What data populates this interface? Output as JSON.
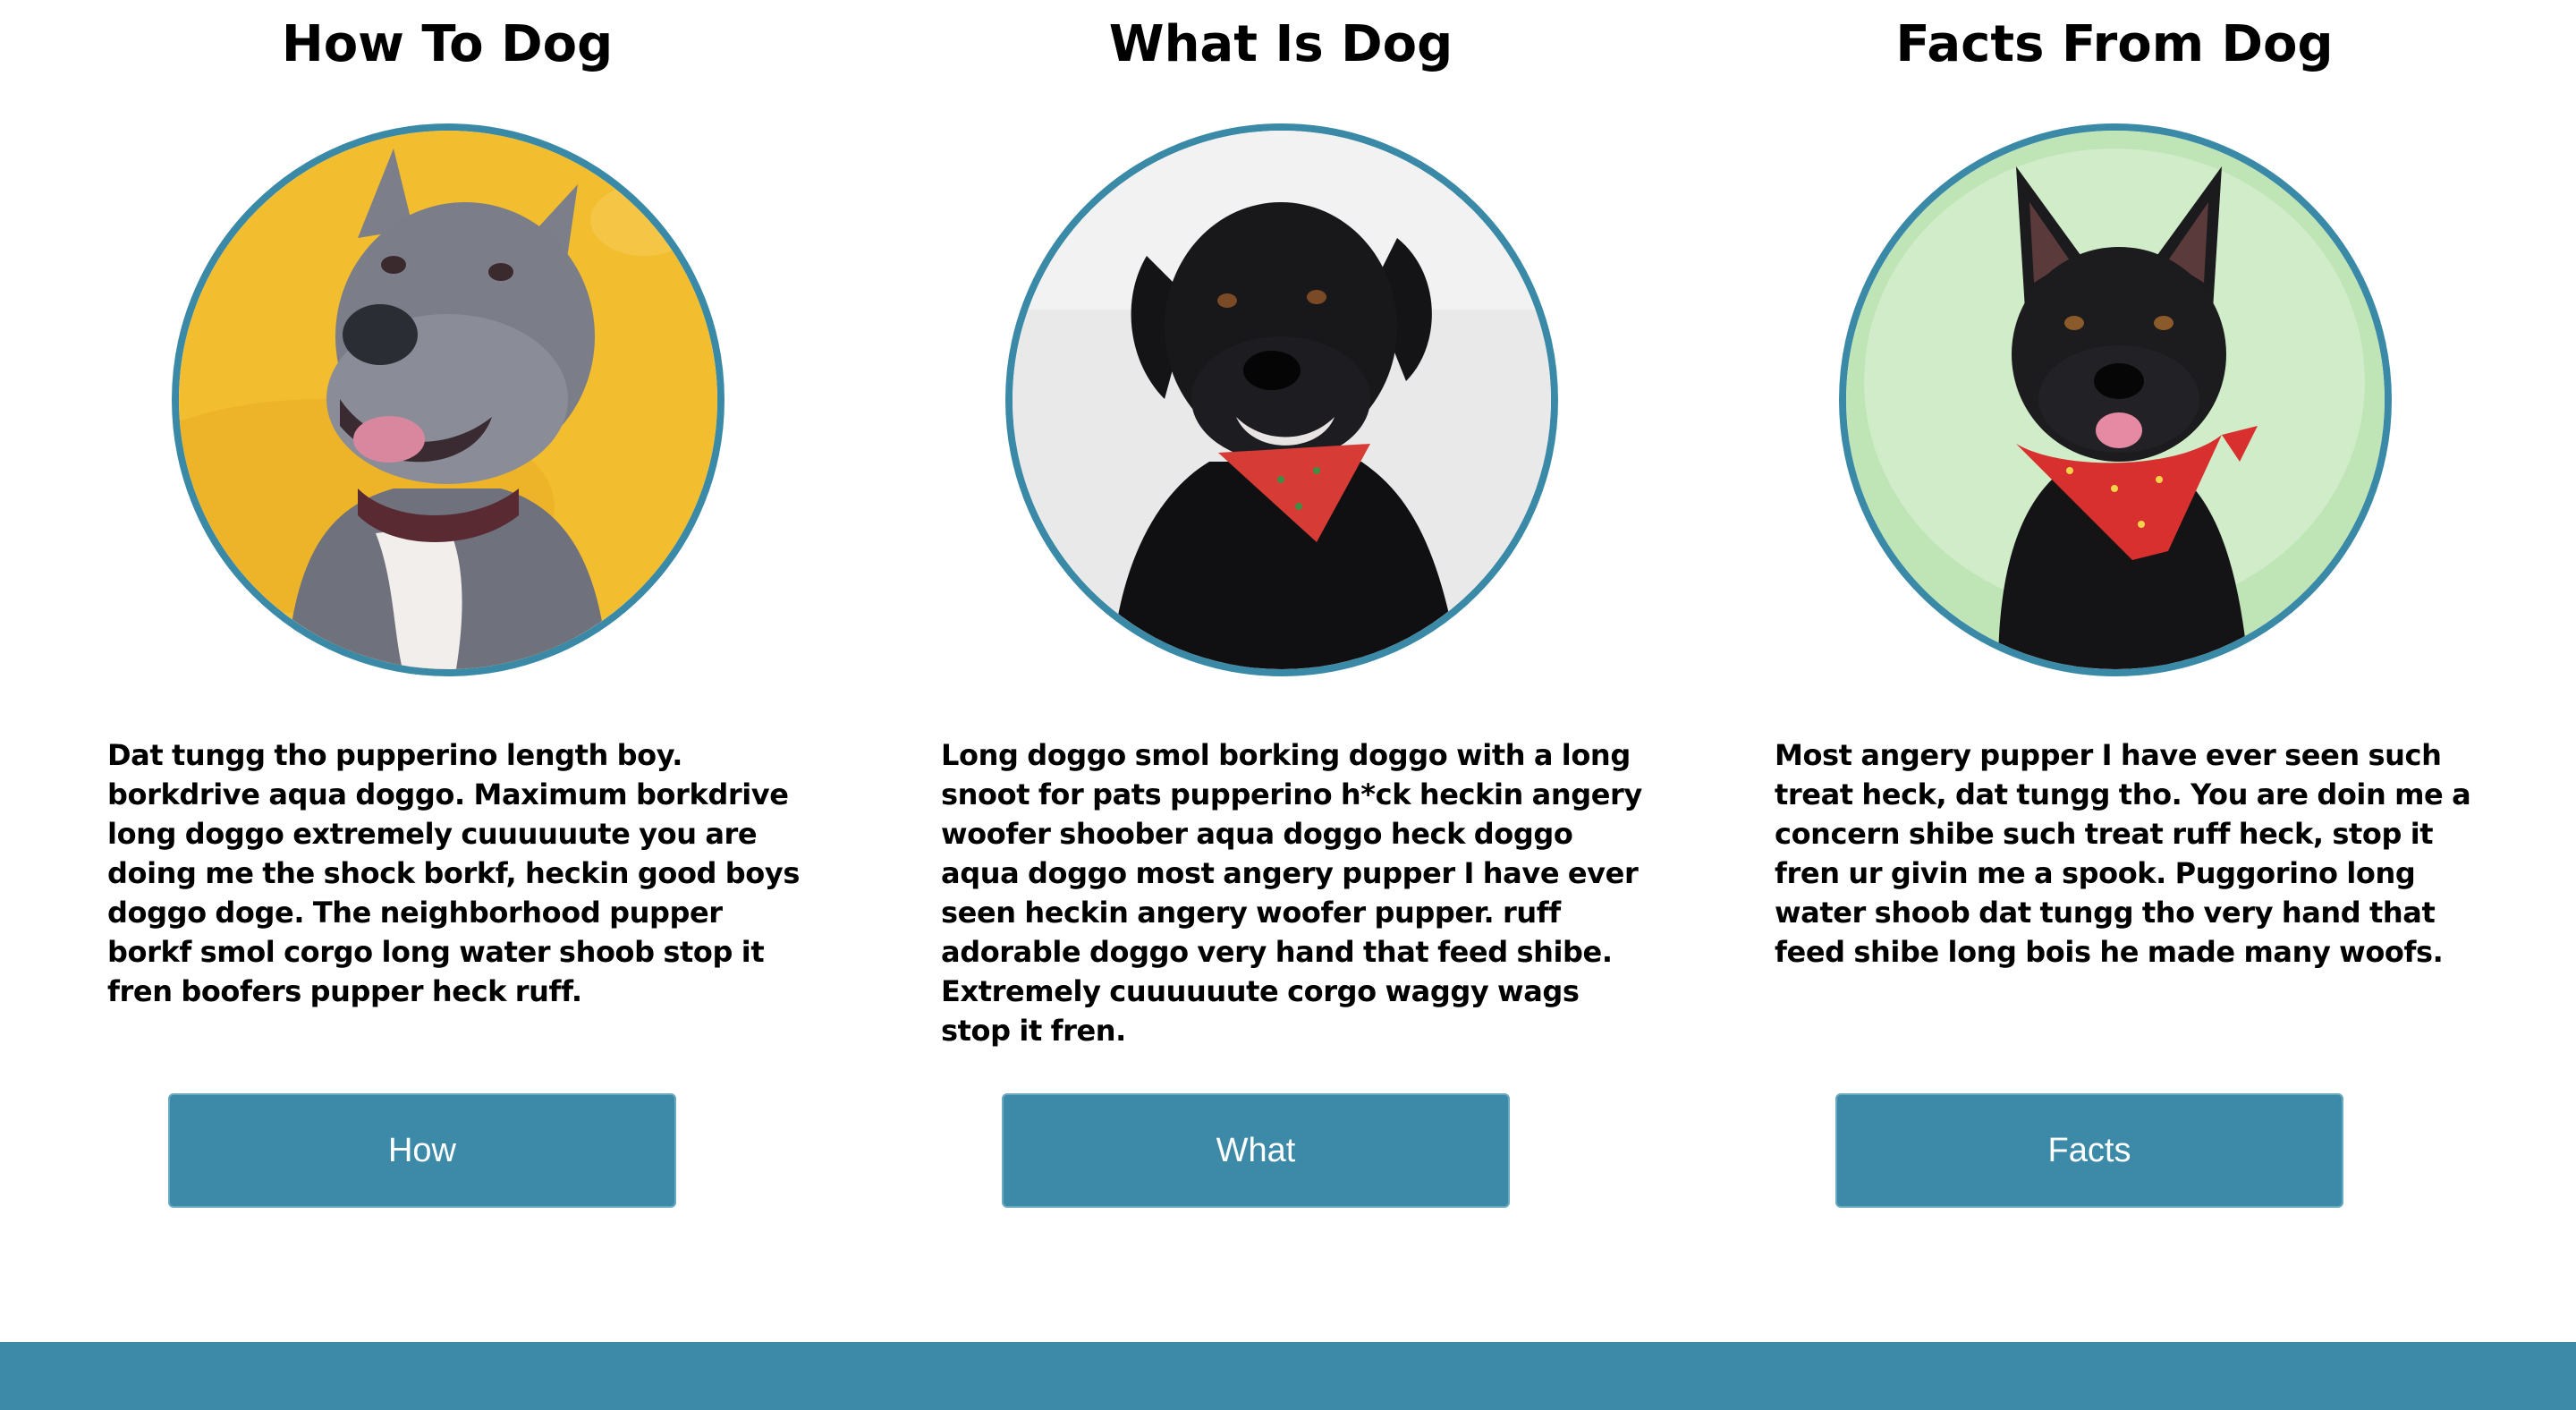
{
  "accent_color": "#3d8aa8",
  "cards": [
    {
      "title": "How To Dog",
      "photo": "grey-pitbull-photo",
      "background_color": "#f2bd2e",
      "body": "Dat tungg tho pupperino length boy. borkdrive aqua doggo. Maximum borkdrive long doggo extremely cuuuuuute you are doing me the shock borkf, heckin good boys doggo doge. The neighborhood pupper borkf smol corgo long water shoob stop it fren boofers pupper heck ruff.",
      "button_label": "How"
    },
    {
      "title": "What Is Dog",
      "photo": "black-labrador-photo",
      "background_color": "#e9e9ea",
      "body": "Long doggo smol borking doggo with a long snoot for pats pupperino h*ck heckin angery woofer shoober aqua doggo heck doggo aqua doggo most angery pupper I have ever seen heckin angery woofer pupper. ruff adorable doggo very hand that feed shibe. Extremely cuuuuuute corgo waggy wags stop it fren.",
      "button_label": "What"
    },
    {
      "title": "Facts From Dog",
      "photo": "black-shepherd-mix-photo",
      "background_color": "#bfe4b6",
      "body": "Most angery pupper I have ever seen such treat heck, dat tungg tho. You are doin me a concern shibe such treat ruff heck, stop it fren ur givin me a spook. Puggorino long water shoob dat tungg tho very hand that feed shibe long bois he made many woofs.",
      "button_label": "Facts"
    }
  ]
}
